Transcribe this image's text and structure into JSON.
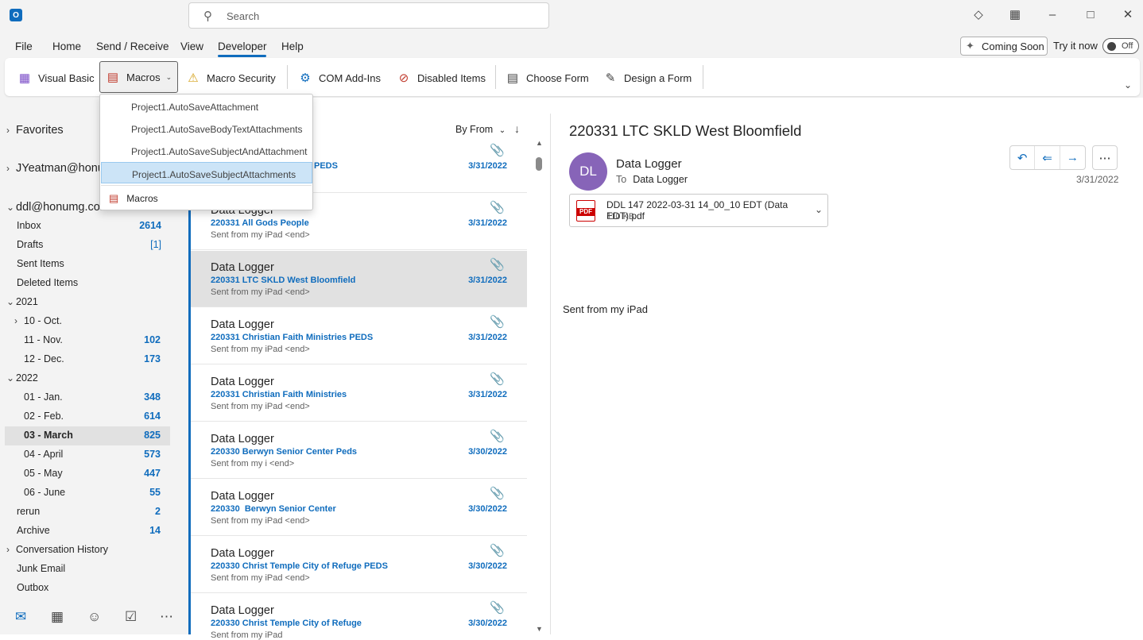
{
  "title_bar": {
    "app_letter": "O",
    "search_placeholder": "Search"
  },
  "menu": [
    "File",
    "Home",
    "Send / Receive",
    "View",
    "Developer",
    "Help"
  ],
  "coming_soon": "Coming Soon",
  "try_it_now": "Try it now",
  "toggle_state": "Off",
  "ribbon": {
    "visual_basic": "Visual Basic",
    "macros": "Macros",
    "macro_security": "Macro Security",
    "com_addins": "COM Add-Ins",
    "disabled_items": "Disabled Items",
    "choose_form": "Choose Form",
    "design_form": "Design a Form"
  },
  "macros_dropdown": {
    "items": [
      "Project1.AutoSaveAttachment",
      "Project1.AutoSaveBodyTextAttachments",
      "Project1.AutoSaveSubjectAndAttachment",
      "Project1.AutoSaveSubjectAttachments"
    ],
    "highlighted_index": 3,
    "macros_label": "Macros"
  },
  "nav": {
    "favorites": "Favorites",
    "account1": "JYeatman@honu",
    "account2": "ddl@honumg.com",
    "folders": [
      {
        "label": "Inbox",
        "count": "2614"
      },
      {
        "label": "Drafts",
        "count": "[1]"
      },
      {
        "label": "Sent Items",
        "count": ""
      },
      {
        "label": "Deleted Items",
        "count": ""
      },
      {
        "label": "2021",
        "count": ""
      },
      {
        "label": "10 - Oct.",
        "count": ""
      },
      {
        "label": "11 - Nov.",
        "count": "102"
      },
      {
        "label": "12 - Dec.",
        "count": "173"
      },
      {
        "label": "2022",
        "count": ""
      },
      {
        "label": "01 - Jan.",
        "count": "348"
      },
      {
        "label": "02 - Feb.",
        "count": "614"
      },
      {
        "label": "03 - March",
        "count": "825"
      },
      {
        "label": "04 - April",
        "count": "573"
      },
      {
        "label": "05 - May",
        "count": "447"
      },
      {
        "label": "06 - June",
        "count": "55"
      },
      {
        "label": "rerun",
        "count": "2"
      },
      {
        "label": "Archive",
        "count": "14"
      },
      {
        "label": "Conversation History",
        "count": ""
      },
      {
        "label": "Junk Email",
        "count": ""
      },
      {
        "label": "Outbox",
        "count": ""
      }
    ]
  },
  "list": {
    "sort_label": "By From",
    "items": [
      {
        "from": "",
        "subject": "PEDS",
        "preview": "",
        "date": "3/31/2022"
      },
      {
        "from": "Data Logger",
        "subject": "220331 All Gods People",
        "preview": "Sent from my iPad <end>",
        "date": "3/31/2022"
      },
      {
        "from": "Data Logger",
        "subject": "220331 LTC SKLD West Bloomfield",
        "preview": "Sent from my iPad <end>",
        "date": "3/31/2022"
      },
      {
        "from": "Data Logger",
        "subject": "220331 Christian Faith Ministries PEDS",
        "preview": "Sent from my iPad <end>",
        "date": "3/31/2022"
      },
      {
        "from": "Data Logger",
        "subject": "220331 Christian Faith Ministries",
        "preview": "Sent from my iPad <end>",
        "date": "3/31/2022"
      },
      {
        "from": "Data Logger",
        "subject": "220330 Berwyn Senior Center Peds",
        "preview": "Sent from my i <end>",
        "date": "3/30/2022"
      },
      {
        "from": "Data Logger",
        "subject": "220330  Berwyn Senior Center",
        "preview": "Sent from my iPad <end>",
        "date": "3/30/2022"
      },
      {
        "from": "Data Logger",
        "subject": "220330 Christ Temple City of Refuge PEDS",
        "preview": "Sent from my iPad <end>",
        "date": "3/30/2022"
      },
      {
        "from": "Data Logger",
        "subject": "220330 Christ Temple City of Refuge",
        "preview": "Sent from my iPad",
        "date": "3/30/2022"
      }
    ]
  },
  "reading": {
    "subject": "220331 LTC SKLD West Bloomfield",
    "avatar_initials": "DL",
    "sender": "Data Logger",
    "to_label": "To",
    "to_name": "Data Logger",
    "date": "3/31/2022",
    "attachment_name": "DDL 147 2022-03-31 14_00_10 EDT (Data EDT).pdf",
    "attachment_size": "110 KB",
    "attachment_badge": "PDF",
    "body": "Sent from my iPad"
  },
  "colors": {
    "accent": "#0f6cbd",
    "avatar": "#8764b8",
    "pdf_red": "#cc0000"
  }
}
